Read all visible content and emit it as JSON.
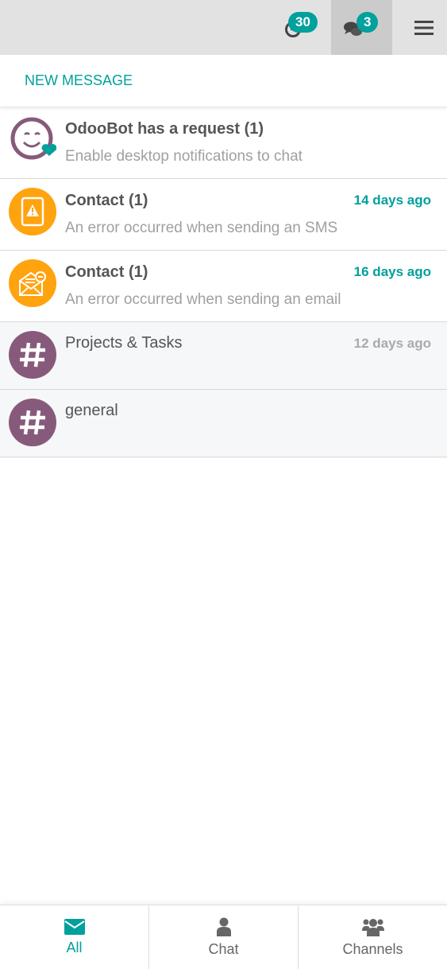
{
  "topbar": {
    "activity_count": "30",
    "messages_count": "3"
  },
  "new_message_label": "NEW MESSAGE",
  "threads": [
    {
      "title": "OdooBot has a request (1)",
      "preview": "Enable desktop notifications to chat",
      "date": ""
    },
    {
      "title": "Contact (1)",
      "preview": "An error occurred when sending an SMS",
      "date": "14 days ago"
    },
    {
      "title": "Contact (1)",
      "preview": "An error occurred when sending an email",
      "date": "16 days ago"
    },
    {
      "title": "Projects & Tasks",
      "preview": "",
      "date": "12 days ago"
    },
    {
      "title": "general",
      "preview": "",
      "date": ""
    }
  ],
  "tabs": [
    {
      "label": "All"
    },
    {
      "label": "Chat"
    },
    {
      "label": "Channels"
    }
  ],
  "colors": {
    "accent": "#00a09d",
    "channel": "#875a7b",
    "failure": "#ffa30f"
  }
}
